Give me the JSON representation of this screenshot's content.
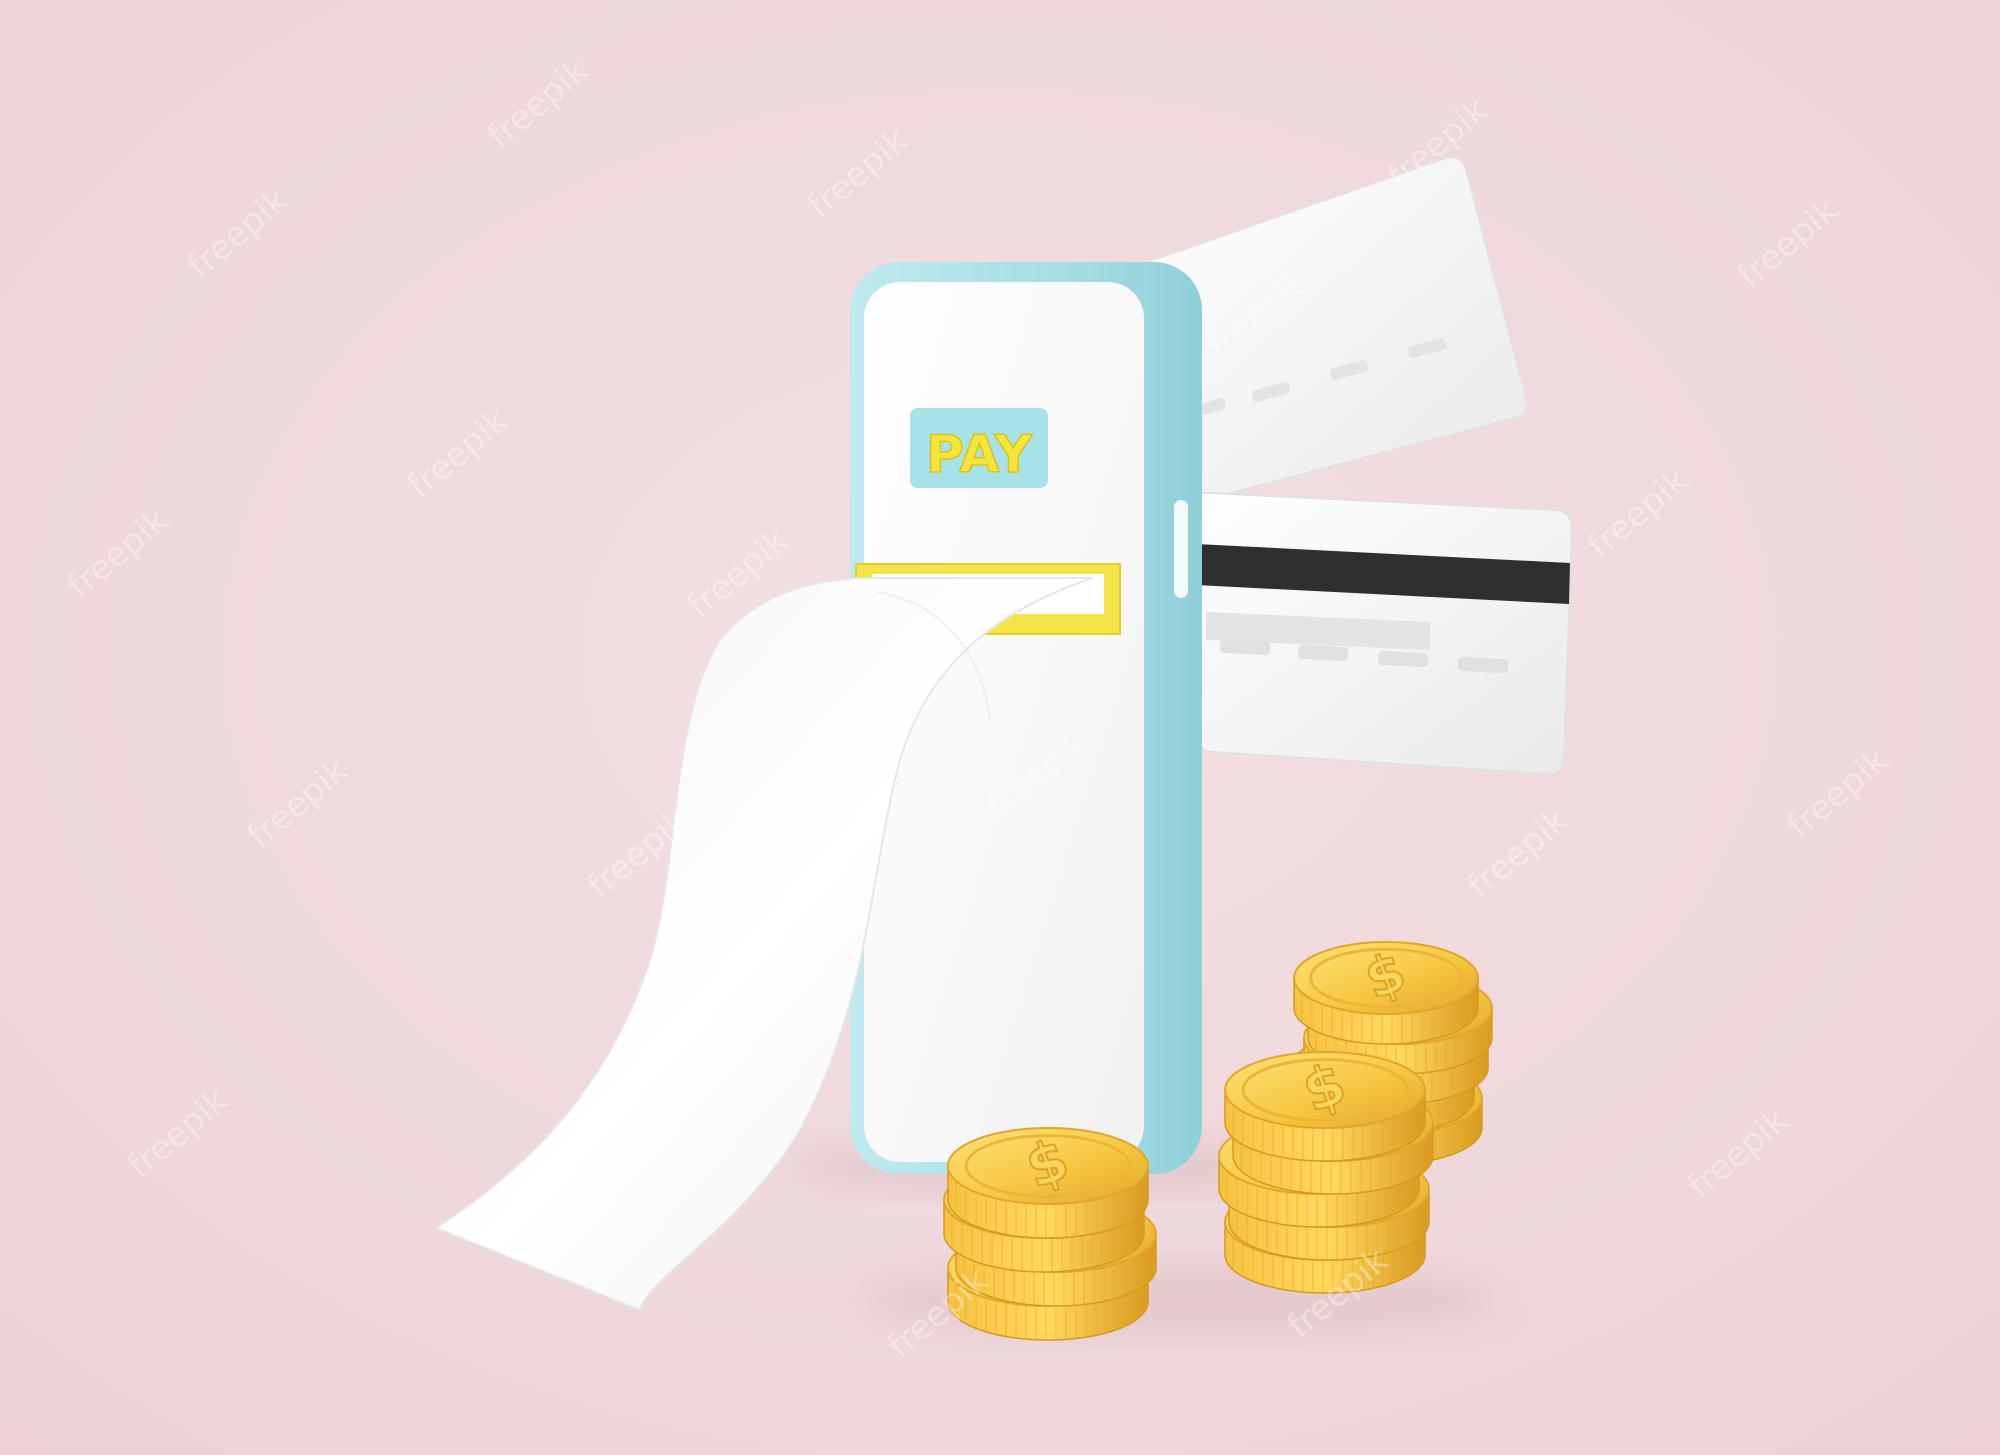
{
  "scene": {
    "description_label": "3D illustration of mobile payment",
    "background_color": "#f0dadd",
    "floor_color": "#ecd3d7"
  },
  "phone": {
    "body_color": "#a7dee5",
    "screen_color": "#ffffff",
    "pay_button": {
      "label": "PAY",
      "background_color": "#a6e2e8",
      "text_color": "#f6e43a"
    },
    "slot_color": "#f3e547"
  },
  "receipt": {
    "paper_color": "#ffffff"
  },
  "cards": {
    "front_card_color": "#f7f7f7",
    "back_card_color": "#f2f2f2",
    "magnetic_stripe_color": "#2e2e2e"
  },
  "coins": {
    "color": "#f5c842",
    "edge_color": "#e4a92a",
    "symbol": "$",
    "stacks": [
      4,
      5,
      5
    ]
  },
  "watermark": {
    "text": "freepik"
  }
}
